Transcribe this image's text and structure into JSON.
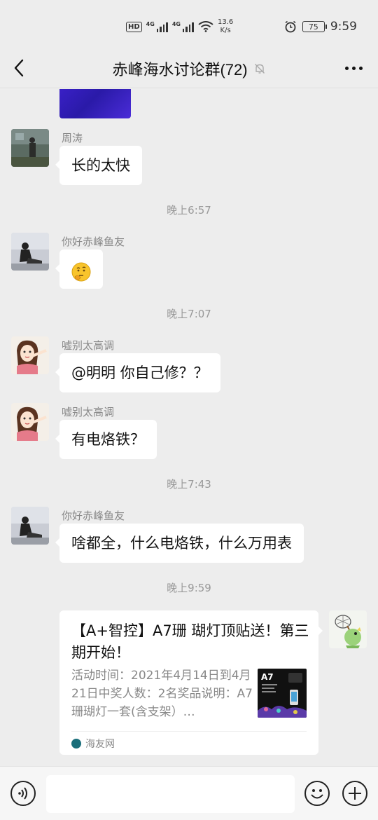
{
  "status_bar": {
    "hd_label": "HD",
    "signal1_label": "4G",
    "signal2_label": "4G",
    "speed_value": "13.6",
    "speed_unit": "K/s",
    "battery_level": "75",
    "clock": "9:59"
  },
  "header": {
    "title": "赤峰海水讨论群(72)",
    "muted": true
  },
  "messages": [
    {
      "type": "image",
      "color": "#3a20c8"
    },
    {
      "sender": "周涛",
      "text": "长的太快"
    },
    {
      "type": "time",
      "text": "晚上6:57"
    },
    {
      "sender": "你好赤峰鱼友",
      "text": "🤔"
    },
    {
      "type": "time",
      "text": "晚上7:07"
    },
    {
      "sender": "嘘别太高调",
      "text": "@明明  你自己修？？"
    },
    {
      "sender": "嘘别太高调",
      "text": "有电烙铁？"
    },
    {
      "type": "time",
      "text": "晚上7:43"
    },
    {
      "sender": "你好赤峰鱼友",
      "text": "啥都全，什么电烙铁，什么万用表"
    },
    {
      "type": "time",
      "text": "晚上9:59"
    }
  ],
  "link_card": {
    "title": "【A+智控】A7珊 瑚灯顶贴送！第三期开始！",
    "description": "活动时间：2021年4月14日到4月21日中奖人数：2名奖品说明：A7珊瑚灯一套(含支架）…",
    "thumb_label": "A7",
    "source": "海友网"
  },
  "colors": {
    "background": "#ededed",
    "bubble": "#ffffff",
    "card_source_icon": "#1a6e7a"
  }
}
